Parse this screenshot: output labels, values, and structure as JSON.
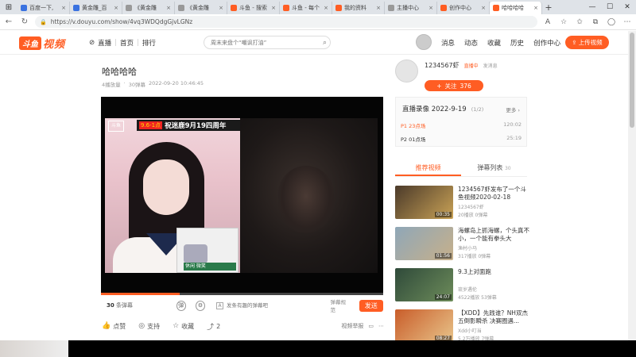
{
  "browser": {
    "tabs": [
      {
        "label": "百度一下,",
        "color": "#3a72e0"
      },
      {
        "label": "黄金雕_百",
        "color": "#3a72e0"
      },
      {
        "label": "《黄金雕",
        "color": "#999999"
      },
      {
        "label": "《黄金雕",
        "color": "#999999"
      },
      {
        "label": "斗鱼 - 搜索",
        "color": "#ff5d23"
      },
      {
        "label": "斗鱼 - 每个",
        "color": "#ff5d23"
      },
      {
        "label": "我的资料",
        "color": "#ff5d23"
      },
      {
        "label": "主播中心",
        "color": "#999999"
      },
      {
        "label": "创作中心",
        "color": "#ff5d23"
      },
      {
        "label": "哈哈哈哈",
        "color": "#ff5d23"
      }
    ],
    "url": "https://v.douyu.com/show/4vq3WDQdgGjvLGNz"
  },
  "header": {
    "logo_badge": "斗鱼",
    "logo_word": "视频",
    "nav": [
      "直播",
      "首页",
      "排行"
    ],
    "search_placeholder": "周末来盘个“嘲讽打油”",
    "links": [
      "消息",
      "动态",
      "收藏",
      "历史",
      "创作中心"
    ],
    "upload": "上传视频"
  },
  "video": {
    "title": "哈哈哈哈",
    "meta_views": "4播放量",
    "meta_danmaku": "30弹幕",
    "meta_date": "2022-09-20 10:46:45",
    "banner_date": "9.6-1点",
    "banner_text": "祝迷鹿9月19四周年",
    "cam_logo": "斗鱼",
    "inset_caption": "休闲 微笑",
    "progress": 0.28
  },
  "danmaku": {
    "count": "30",
    "count_label": "条弹幕",
    "input_placeholder": "发条有趣的弹幕吧",
    "rule": "弹幕规范",
    "send": "发送"
  },
  "actions": {
    "like": "点赞",
    "support": "支持",
    "collect": "收藏",
    "share": "2",
    "report": "视频举报"
  },
  "uploader": {
    "name": "1234567虾",
    "tag": "直播中",
    "message": "发消息",
    "follow": "关注",
    "followers": "376"
  },
  "playlist": {
    "title": "直播录像 2022-9-19",
    "count": "(1/2)",
    "more": "更多",
    "items": [
      {
        "label": "P1 23点场",
        "duration": "120:02",
        "active": true
      },
      {
        "label": "P2 01点场",
        "duration": "25:19",
        "active": false
      }
    ]
  },
  "tabs": {
    "recommended": "推荐视频",
    "danmaku_list": "弹幕列表",
    "danmaku_count": "30"
  },
  "recommendations": [
    {
      "title": "1234567虾发布了一个斗鱼视频2020-02-18",
      "author": "1234567虾",
      "stats": "20播放   0弹幕",
      "duration": "00:35",
      "thumb_a": "#4b3a2a",
      "thumb_b": "#c9a256"
    },
    {
      "title": "海螺岛上抓海螺，个头真不小，一个能有拳头大",
      "author": "渔村小马",
      "stats": "317播放   0弹幕",
      "duration": "01:56",
      "thumb_a": "#8fa7b8",
      "thumb_b": "#c7b08a"
    },
    {
      "title": "9.3上对面跑",
      "author": "琉岁遇伦",
      "stats": "4522播放   53弹幕",
      "duration": "24:07",
      "thumb_a": "#2f4a3a",
      "thumb_b": "#6d8c5a"
    },
    {
      "title": "【XDD】先践谁？NH双杰五倒影瞬杀 决赛圈遇...",
      "author": "Xdd小叮当",
      "stats": "5.2万播放   7弹幕",
      "duration": "08:27",
      "thumb_a": "#c95d2a",
      "thumb_b": "#e8c48a"
    }
  ]
}
